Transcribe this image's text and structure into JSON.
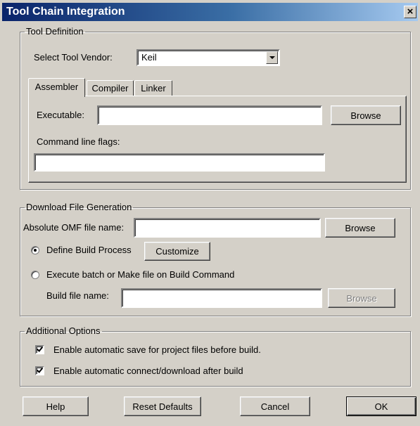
{
  "window": {
    "title": "Tool Chain Integration",
    "close_glyph": "×"
  },
  "tool_definition": {
    "legend": "Tool Definition",
    "vendor_label": "Select Tool Vendor:",
    "vendor_value": "Keil",
    "tabs": [
      {
        "label": "Assembler",
        "active": true
      },
      {
        "label": "Compiler",
        "active": false
      },
      {
        "label": "Linker",
        "active": false
      }
    ],
    "executable_label": "Executable:",
    "executable_value": "",
    "browse_label": "Browse",
    "flags_label": "Command line flags:",
    "flags_value": ""
  },
  "download": {
    "legend": "Download File Generation",
    "omf_label": "Absolute OMF file name:",
    "omf_value": "",
    "browse_label": "Browse",
    "radio_define": {
      "label": "Define Build Process",
      "checked": true
    },
    "customize_label": "Customize",
    "radio_batch": {
      "label": "Execute batch or Make file on Build Command",
      "checked": false
    },
    "build_file_label": "Build file name:",
    "build_file_value": "",
    "build_browse_label": "Browse",
    "build_browse_disabled": true
  },
  "additional": {
    "legend": "Additional Options",
    "options": [
      {
        "label": "Enable automatic save for project files before build.",
        "checked": true
      },
      {
        "label": "Enable automatic connect/download after build",
        "checked": true
      }
    ]
  },
  "footer": {
    "help_label": "Help",
    "reset_label": "Reset Defaults",
    "cancel_label": "Cancel",
    "ok_label": "OK"
  },
  "colors": {
    "dialog_bg": "#d4d0c8",
    "title_start": "#0a246a",
    "title_end": "#a6caf0",
    "disabled_text": "#808080"
  },
  "icons": {
    "close": "close-icon",
    "dropdown": "chevron-down-icon",
    "check": "checkmark-icon"
  }
}
